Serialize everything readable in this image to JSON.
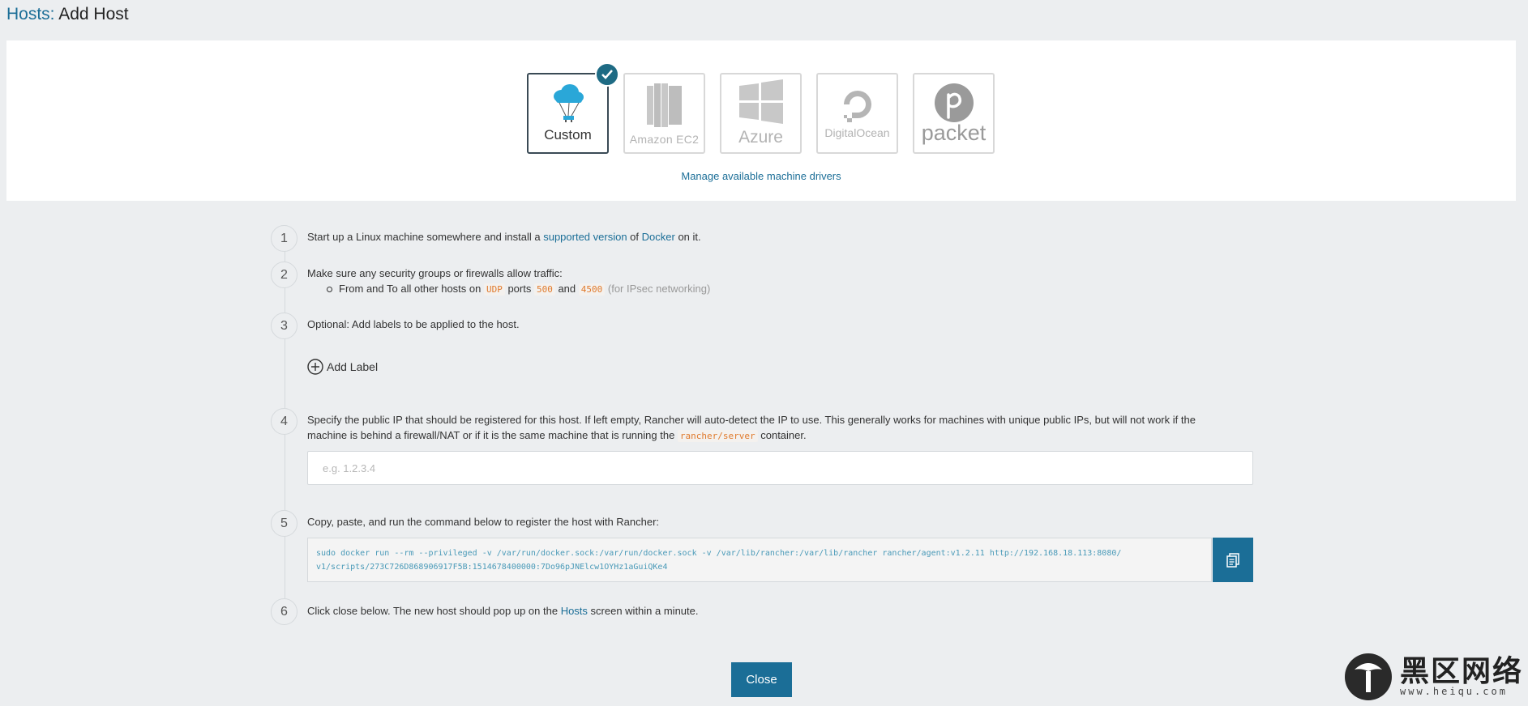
{
  "header": {
    "breadcrumb": "Hosts:",
    "title": "Add Host"
  },
  "drivers": [
    {
      "label": "Custom",
      "selected": true,
      "icon": "parachute-cloud-icon"
    },
    {
      "label": "Amazon EC2",
      "selected": false,
      "icon": "aws-ec2-icon"
    },
    {
      "label": "Azure",
      "selected": false,
      "icon": "windows-logo-icon"
    },
    {
      "label": "DigitalOcean",
      "selected": false,
      "icon": "digitalocean-logo-icon"
    },
    {
      "label": "packet",
      "selected": false,
      "icon": "packet-logo-icon"
    }
  ],
  "manage_link": "Manage available machine drivers",
  "steps": {
    "s1": {
      "num": "1",
      "pre": "Start up a Linux machine somewhere and install a ",
      "link1": "supported version",
      "mid": " of ",
      "link2": "Docker",
      "post": " on it."
    },
    "s2": {
      "num": "2",
      "text": "Make sure any security groups or firewalls allow traffic:",
      "bullet_pre": "From and To all other hosts on ",
      "proto": "UDP",
      "ports_word": " ports ",
      "port1": "500",
      "and_word": " and ",
      "port2": "4500",
      "note": " (for IPsec networking)"
    },
    "s3": {
      "num": "3",
      "text": "Optional: Add labels to be applied to the host.",
      "add_label": "Add Label"
    },
    "s4": {
      "num": "4",
      "line1": "Specify the public IP that should be registered for this host. If left empty, Rancher will auto-detect the IP to use. This generally works for machines with unique public IPs, but will not work if the",
      "line2_pre": "machine is behind a firewall/NAT or if it is the same machine that is running the ",
      "code": "rancher/server",
      "line2_post": " container.",
      "placeholder": "e.g. 1.2.3.4"
    },
    "s5": {
      "num": "5",
      "text": "Copy, paste, and run the command below to register the host with Rancher:",
      "cmd_line1": "sudo docker run --rm --privileged -v /var/run/docker.sock:/var/run/docker.sock -v /var/lib/rancher:/var/lib/rancher rancher/agent:v1.2.11 http://192.168.18.113:8080/",
      "cmd_line2": "v1/scripts/273C726D868906917F5B:1514678400000:7Do96pJNElcw1OYHz1aGuiQKe4"
    },
    "s6": {
      "num": "6",
      "pre": "Click close below. The new host should pop up on the ",
      "link": "Hosts",
      "post": " screen within a minute."
    }
  },
  "close_label": "Close",
  "watermark": {
    "text": "黑区网络",
    "sub": "www.heiqu.com"
  },
  "colors": {
    "accent": "#1b6e97",
    "background": "#eceef0",
    "code": "#e07a2c",
    "selected_badge": "#1e6b84"
  }
}
